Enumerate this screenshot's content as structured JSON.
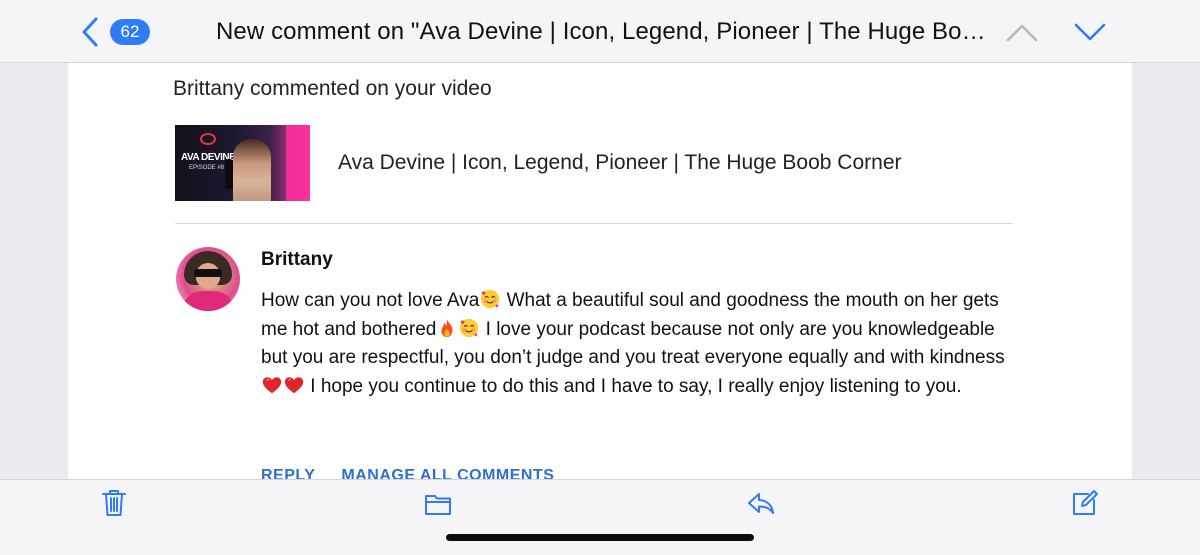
{
  "header": {
    "unread_count": "62",
    "subject": "New comment on \"Ava Devine | Icon, Legend, Pioneer | The Huge Boob Corner\""
  },
  "email": {
    "headline": "Brittany commented on your video",
    "video": {
      "title": "Ava Devine | Icon, Legend, Pioneer | The Huge Boob Corner",
      "thumbnail_name": "AVA DEVINE",
      "thumbnail_episode": "EPISODE #8"
    },
    "comment": {
      "author": "Brittany",
      "segments": [
        {
          "text": "How can you not love Ava"
        },
        {
          "emoji": "smiling-face-with-hearts"
        },
        {
          "text": " What a beautiful soul and goodness the mouth on her gets me hot and bothered"
        },
        {
          "emoji": "fire"
        },
        {
          "emoji": "smiling-face-with-hearts"
        },
        {
          "text": " I love your podcast because not only are you knowledgeable but you are respectful, you don’t judge and you treat everyone equally and with kindness"
        },
        {
          "emoji": "red-heart"
        },
        {
          "emoji": "red-heart"
        },
        {
          "text": " I hope you continue to do this and I have to say, I really enjoy listening to you."
        }
      ]
    },
    "actions": {
      "reply": "REPLY",
      "manage": "MANAGE ALL COMMENTS"
    }
  },
  "toolbar": {
    "icons": [
      "trash-icon",
      "folder-icon",
      "reply-icon",
      "compose-icon"
    ]
  },
  "colors": {
    "accent": "#2f7cf6",
    "link": "#2f6fd1",
    "bar_background": "#f5f5f7"
  }
}
